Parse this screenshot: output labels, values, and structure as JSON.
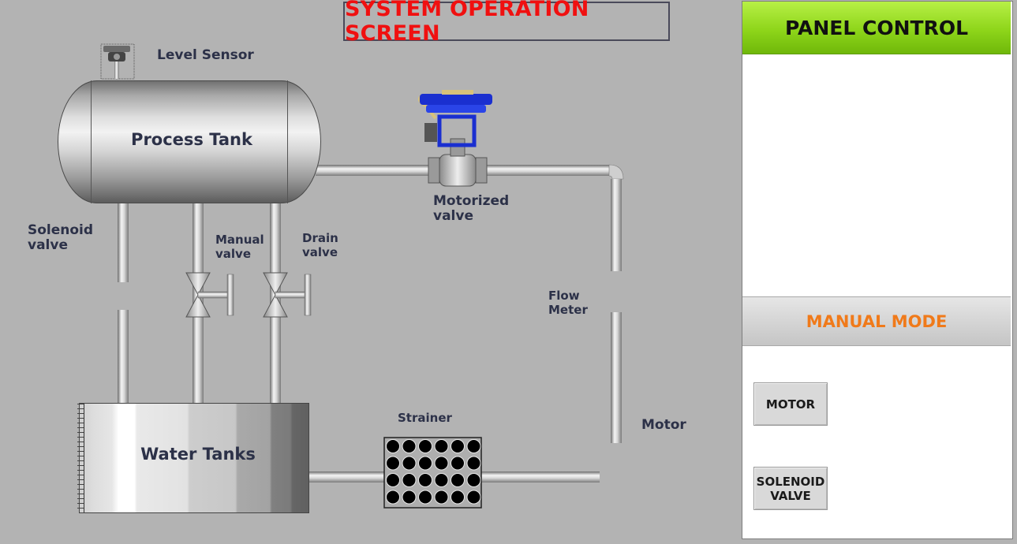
{
  "title": "SYSTEM OPERATION SCREEN",
  "diagram": {
    "level_sensor": "Level Sensor",
    "process_tank": "Process Tank",
    "motorized_valve": [
      "Motorized",
      "valve"
    ],
    "solenoid_valve": [
      "Solenoid",
      "valve"
    ],
    "manual_valve": [
      "Manual",
      "valve"
    ],
    "drain_valve": [
      "Drain",
      "valve"
    ],
    "flow_meter": [
      "Flow",
      "Meter"
    ],
    "water_tanks": "Water Tanks",
    "strainer": "Strainer",
    "motor": "Motor"
  },
  "panel": {
    "header": "PANEL CONTROL",
    "mode": "MANUAL MODE",
    "motor_button": "MOTOR",
    "solenoid_button": [
      "SOLENOID",
      "VALVE"
    ]
  },
  "colors": {
    "title_text": "#f01010",
    "panel_header_green": "#8ed51a",
    "mode_text": "#f07a1a",
    "valve_blue": "#1a2fd0"
  }
}
